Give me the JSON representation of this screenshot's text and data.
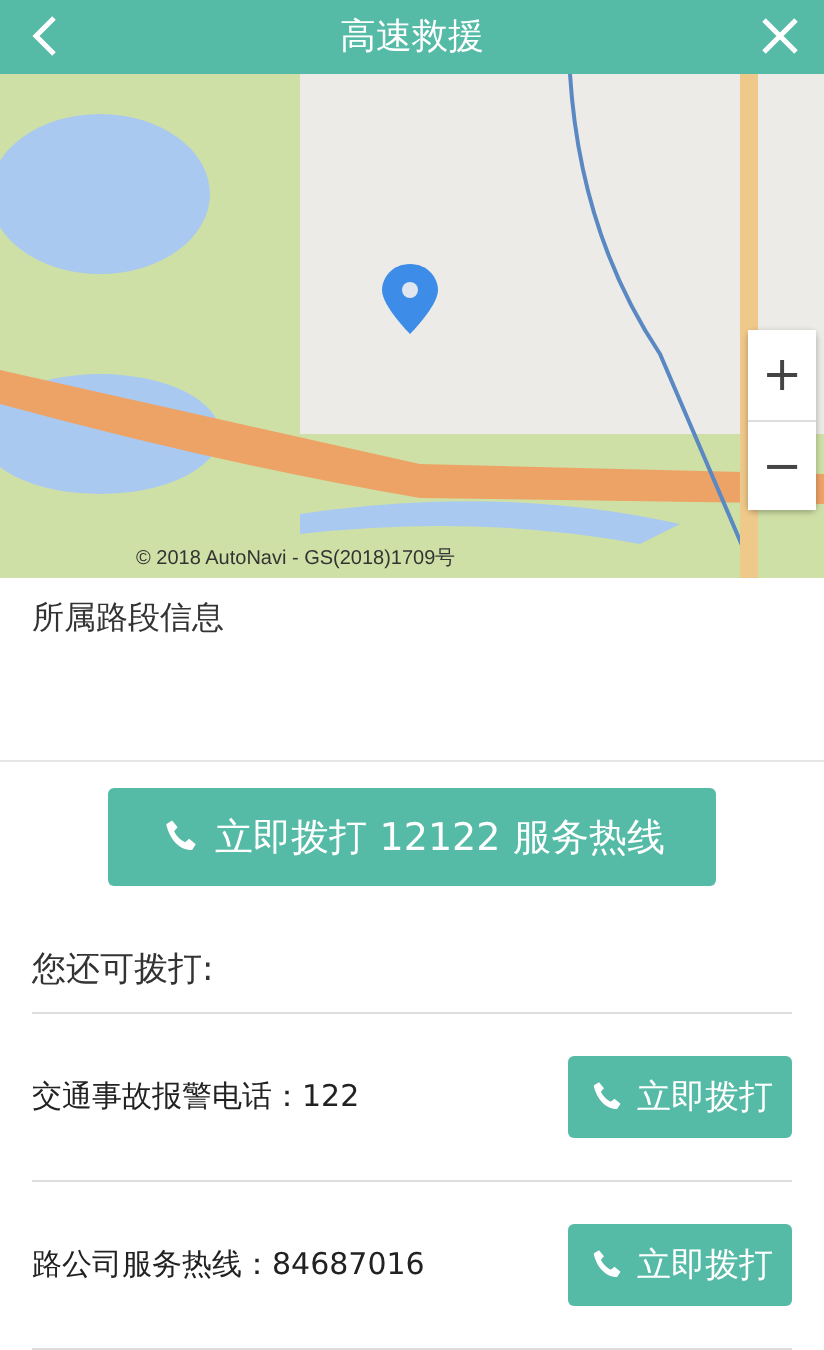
{
  "header": {
    "title": "高速救援"
  },
  "map": {
    "attribution": "© 2018 AutoNavi - GS(2018)1709号",
    "zoom_in": "+",
    "zoom_out": "−"
  },
  "road_section": {
    "heading": "所属路段信息"
  },
  "main_call": {
    "label": "立即拨打 12122 服务热线"
  },
  "others": {
    "heading": "您还可拨打:"
  },
  "contacts": [
    {
      "label": "交通事故报警电话：122",
      "button": "立即拨打"
    },
    {
      "label": "路公司服务热线：84687016",
      "button": "立即拨打"
    }
  ]
}
